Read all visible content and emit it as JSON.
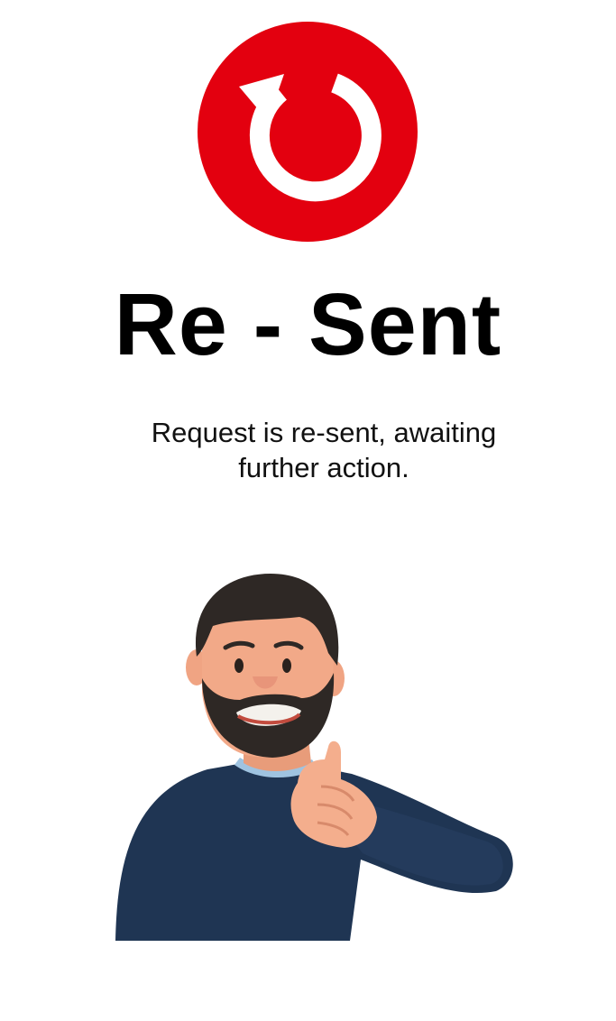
{
  "status": {
    "icon": "refresh-icon",
    "accent_color": "#E3000F",
    "title": "Re - Sent",
    "message": "Request is re-sent, awaiting further action."
  },
  "illustration": {
    "name": "man-thumbs-up-illustration",
    "shirt_color": "#1F3553",
    "skin_color": "#F2A988",
    "hair_color": "#2E2825"
  }
}
